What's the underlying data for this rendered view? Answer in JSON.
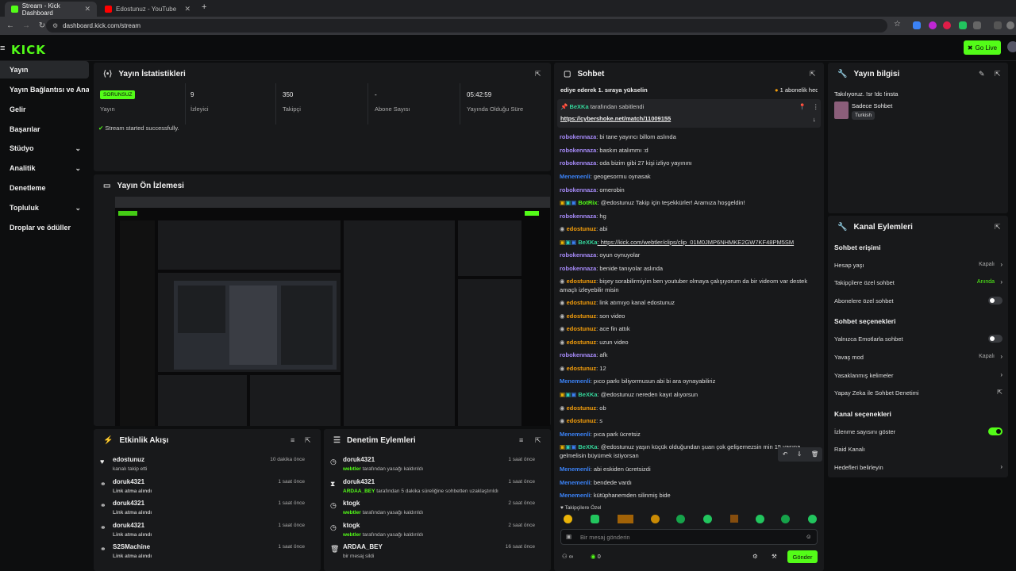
{
  "browser": {
    "tabs": [
      {
        "title": "Stream - Kick Dashboard",
        "fav_color": "#53fc18"
      },
      {
        "title": "Edostunuz - YouTube",
        "fav_color": "#ff0000"
      }
    ],
    "new_tab": "+",
    "url": "dashboard.kick.com/stream"
  },
  "kick": {
    "logo": "KICK",
    "go_live": "Go Live"
  },
  "sidebar": {
    "items": [
      {
        "label": "Yayın",
        "chev": ""
      },
      {
        "label": "Yayın Bağlantısı ve Anahtarı",
        "chev": ""
      },
      {
        "label": "Gelir",
        "chev": ""
      },
      {
        "label": "Başarılar",
        "chev": ""
      },
      {
        "label": "Stüdyo",
        "chev": "⌄"
      },
      {
        "label": "Analitik",
        "chev": "⌄"
      },
      {
        "label": "Denetleme",
        "chev": ""
      },
      {
        "label": "Topluluk",
        "chev": "⌄"
      },
      {
        "label": "Droplar ve ödüller",
        "chev": ""
      }
    ]
  },
  "stats": {
    "title": "Yayın İstatistikleri",
    "badge": "SORUNSUZ",
    "cells": [
      {
        "value": "",
        "label": "Yayın"
      },
      {
        "value": "9",
        "label": "İzleyici"
      },
      {
        "value": "350",
        "label": "Takipçi"
      },
      {
        "value": "-",
        "label": "Abone Sayısı"
      },
      {
        "value": "05:42:59",
        "label": "Yayında Olduğu Süre"
      }
    ],
    "status_msg": "Stream started successfully."
  },
  "preview": {
    "title": "Yayın Ön İzlemesi"
  },
  "activity": {
    "title": "Etkinlik Akışı",
    "rows": [
      {
        "icon": "heart-icon",
        "glyph": "♥",
        "name": "edostunuz",
        "sub": "kanalı takip etti",
        "time": "10 dakika önce"
      },
      {
        "icon": "link-icon",
        "glyph": "⚭",
        "name": "doruk4321",
        "sub": "Link atma alındı",
        "time": "1 saat önce"
      },
      {
        "icon": "link-icon",
        "glyph": "⚭",
        "name": "doruk4321",
        "sub": "Link atma alındı",
        "time": "1 saat önce"
      },
      {
        "icon": "link-icon",
        "glyph": "⚭",
        "name": "doruk4321",
        "sub": "Link atma alındı",
        "time": "1 saat önce"
      },
      {
        "icon": "link-icon",
        "glyph": "⚭",
        "name": "S2SMachine",
        "sub": "Link atma alındı",
        "time": "1 saat önce"
      }
    ]
  },
  "moderation": {
    "title": "Denetim Eylemleri",
    "rows": [
      {
        "icon": "clock-icon",
        "glyph": "◷",
        "name": "doruk4321",
        "actor": "webtler",
        "sub": " tarafından yasağı kaldırıldı",
        "time": "1 saat önce"
      },
      {
        "icon": "hourglass-icon",
        "glyph": "⧗",
        "name": "doruk4321",
        "actor": "ARDAA_BEY",
        "sub": " tarafından 5 dakika süreliğine sohbetten uzaklaştırıldı",
        "time": "1 saat önce"
      },
      {
        "icon": "clock-icon",
        "glyph": "◷",
        "name": "ktogk",
        "actor": "webtler",
        "sub": " tarafından yasağı kaldırıldı",
        "time": "2 saat önce"
      },
      {
        "icon": "clock-icon",
        "glyph": "◷",
        "name": "ktogk",
        "actor": "webtler",
        "sub": " tarafından yasağı kaldırıldı",
        "time": "2 saat önce"
      },
      {
        "icon": "trash-icon",
        "glyph": "🗑",
        "name": "ARDAA_BEY",
        "actor": "",
        "sub": "bir mesaj sildi",
        "time": "16 saat önce"
      }
    ]
  },
  "chat": {
    "title": "Sohbet",
    "top_msg": "ediye ederek 1. sıraya yükselin",
    "top_right": "1 abonelik hediye ed",
    "pinned_by": "BeXKa",
    "pinned_by_suffix": " tarafından sabitlendi",
    "pinned_link": "https://cybershoke.net/match/11009155",
    "messages": [
      {
        "user": "robokennaza",
        "color": "#a78bfa",
        "text": ": bi tane yayıncı billom aslında"
      },
      {
        "user": "robokennaza",
        "color": "#a78bfa",
        "text": ": baskın atalımmı :d"
      },
      {
        "user": "robokennaza",
        "color": "#a78bfa",
        "text": ": oda bizim gibi 27 kişi izliyo yayınını"
      },
      {
        "user": "Menemenli",
        "color": "#3b82f6",
        "text": ": geogesormu oynasak"
      },
      {
        "user": "robokennaza",
        "color": "#a78bfa",
        "text": ": omerobin"
      },
      {
        "user": "BotRix",
        "color": "#53fc18",
        "text": ": @edostunuz Takip için teşekkürler! Aramıza hoşgeldin!"
      },
      {
        "user": "robokennaza",
        "color": "#a78bfa",
        "text": ": hg"
      },
      {
        "user": "edostunuz",
        "color": "#f59e0b",
        "text": ": abi"
      },
      {
        "user": "BeXKa",
        "color": "#34d399",
        "text": ": https://kick.com/webtler/clips/clip_01M0JMP6NHMKE2GW7KF48PM5SM"
      },
      {
        "user": "robokennaza",
        "color": "#a78bfa",
        "text": ": oyun oynuyolar"
      },
      {
        "user": "robokennaza",
        "color": "#a78bfa",
        "text": ": benide tanıyolar aslında"
      },
      {
        "user": "edostunuz",
        "color": "#f59e0b",
        "text": ": bişey sorabilirmiyim ben youtuber olmaya çalışıyorum da bir videom var destek amaçlı izleyebilir misin"
      },
      {
        "user": "edostunuz",
        "color": "#f59e0b",
        "text": ": link atımıyo kanal edostunuz"
      },
      {
        "user": "edostunuz",
        "color": "#f59e0b",
        "text": ": son video"
      },
      {
        "user": "edostunuz",
        "color": "#f59e0b",
        "text": ": ace fin attık"
      },
      {
        "user": "edostunuz",
        "color": "#f59e0b",
        "text": ": uzun video"
      },
      {
        "user": "robokennaza",
        "color": "#a78bfa",
        "text": ": afk"
      },
      {
        "user": "edostunuz",
        "color": "#f59e0b",
        "text": ": 12"
      },
      {
        "user": "Menemenli",
        "color": "#3b82f6",
        "text": ": pıco parkı biliyormusun abi bi ara oynayabiliriz"
      },
      {
        "user": "BeXKa",
        "color": "#34d399",
        "text": ": @edostunuz nereden kayıt alıyorsun"
      },
      {
        "user": "edostunuz",
        "color": "#f59e0b",
        "text": ": ob"
      },
      {
        "user": "edostunuz",
        "color": "#f59e0b",
        "text": ": s"
      },
      {
        "user": "Menemenli",
        "color": "#3b82f6",
        "text": ": pıca park ücretsiz"
      },
      {
        "user": "BeXKa",
        "color": "#34d399",
        "text": ": @edostunuz yaşın küçük olduğundan şuan çok gelişemezsin min 15 yaşına gelmelisin büyümek istiyorsan"
      },
      {
        "user": "Menemenli",
        "color": "#3b82f6",
        "text": ": abi eskiden ücretsizdi"
      },
      {
        "user": "Menemenli",
        "color": "#3b82f6",
        "text": ": bendede vardı"
      },
      {
        "user": "Menemenli",
        "color": "#3b82f6",
        "text": ": kütüphanemden silinmiş bide"
      }
    ],
    "followers_only": "Takipçilere Özel",
    "input_placeholder": "Bir mesaj gönderin",
    "count": "0",
    "send": "Gönder"
  },
  "stream_info": {
    "title": "Yayın bilgisi",
    "stream_title": "Takılıyoruz. !sr !dc !insta",
    "category": "Sadece Sohbet",
    "tag": "Turkish"
  },
  "channel_actions": {
    "title": "Kanal Eylemleri",
    "chat_access_head": "Sohbet erişimi",
    "account_age": {
      "label": "Hesap yaşı",
      "value": "Kapalı"
    },
    "followers_chat": {
      "label": "Takipçilere özel sohbet",
      "value": "Anında"
    },
    "subs_chat": {
      "label": "Abonelere özel sohbet"
    },
    "chat_options_head": "Sohbet seçenekleri",
    "emote_only": {
      "label": "Yalnızca Emotlarla sohbet"
    },
    "slow_mode": {
      "label": "Yavaş mod",
      "value": "Kapalı"
    },
    "banned_words": {
      "label": "Yasaklanmış kelimeler"
    },
    "ai_moderation": {
      "label": "Yapay Zeka ile Sohbet Denetimi"
    },
    "channel_options_head": "Kanal seçenekleri",
    "show_viewers": {
      "label": "İzlenme sayısını göster"
    },
    "raid": {
      "label": "Raid Kanalı"
    },
    "goals": {
      "label": "Hedefleri belirleyin"
    }
  },
  "colors": {
    "accent": "#53fc18",
    "panel": "#18191b",
    "bg": "#0d0e0f"
  }
}
